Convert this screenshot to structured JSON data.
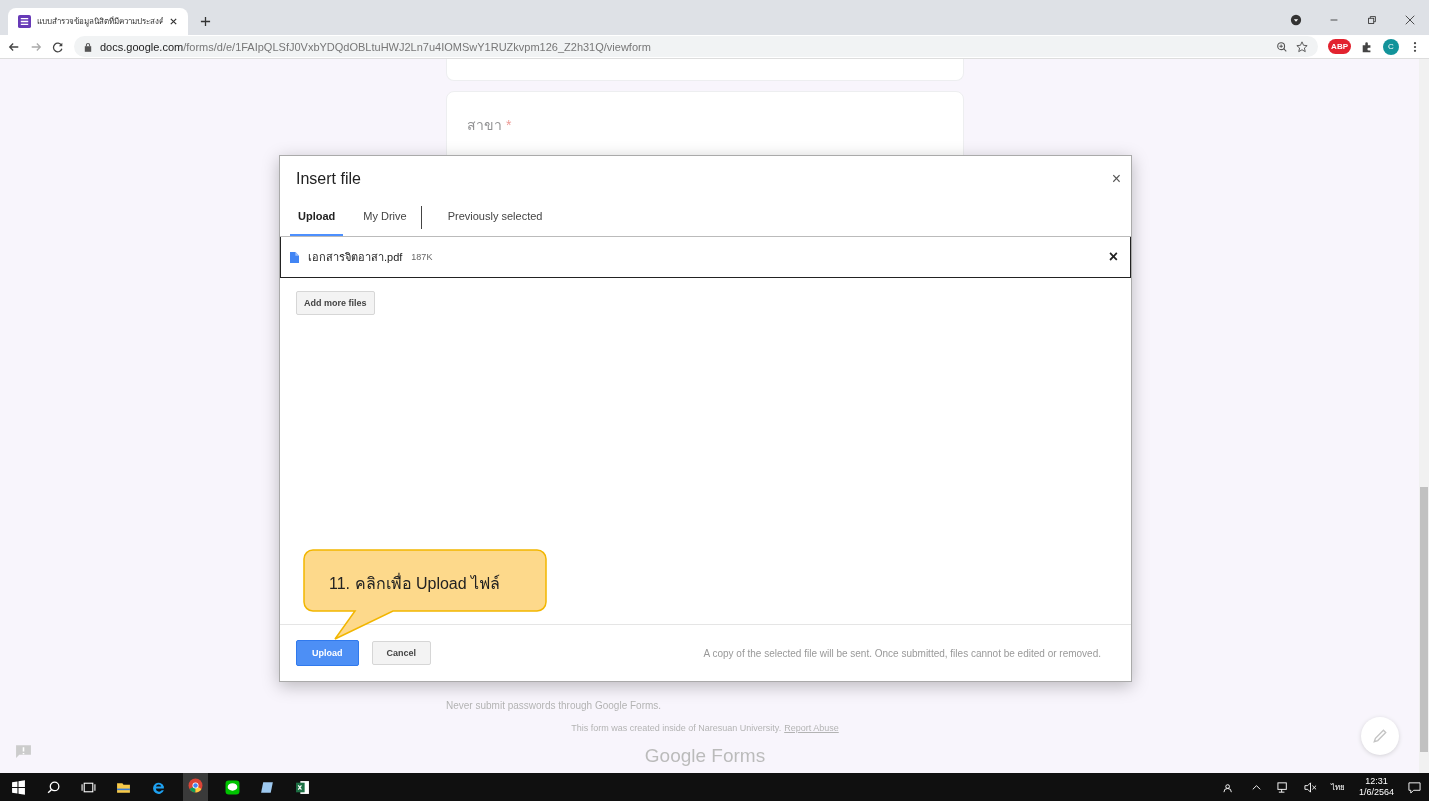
{
  "browser": {
    "tab_title": "แบบสำรวจข้อมูลนิสิตที่มีความประสงค์",
    "url_host": "docs.google.com",
    "url_path": "/forms/d/e/1FAIpQLSfJ0VxbYDQdOBLtuHWJ2Ln7u4IOMSwY1RUZkvpm126_Z2h31Q/viewform",
    "profile_initial": "C",
    "adblock_label": "ABP"
  },
  "form": {
    "question_label": "สาขา",
    "required_mark": "*",
    "footer_note": "Never submit passwords through Google Forms.",
    "created_text": "This form was created inside of Naresuan University.",
    "report_link": "Report Abuse",
    "brand_google": "Google",
    "brand_forms": "Forms"
  },
  "dialog": {
    "title": "Insert file",
    "close": "×",
    "tabs": [
      {
        "label": "Upload",
        "selected": true
      },
      {
        "label": "My Drive",
        "selected": false
      },
      {
        "label": "Previously selected",
        "selected": false
      }
    ],
    "files": [
      {
        "name": "เอกสารจิตอาสา.pdf",
        "size": "187K",
        "remove": "×"
      }
    ],
    "add_more": "Add more files",
    "upload": "Upload",
    "cancel": "Cancel",
    "note": "A copy of the selected file will be sent. Once submitted, files cannot be edited or removed."
  },
  "callout": {
    "number": "11.",
    "text": "คลิกเพื่อ Upload ไฟล์"
  },
  "taskbar": {
    "language": "ไทย",
    "time": "12:31",
    "date": "1/6/2564"
  }
}
